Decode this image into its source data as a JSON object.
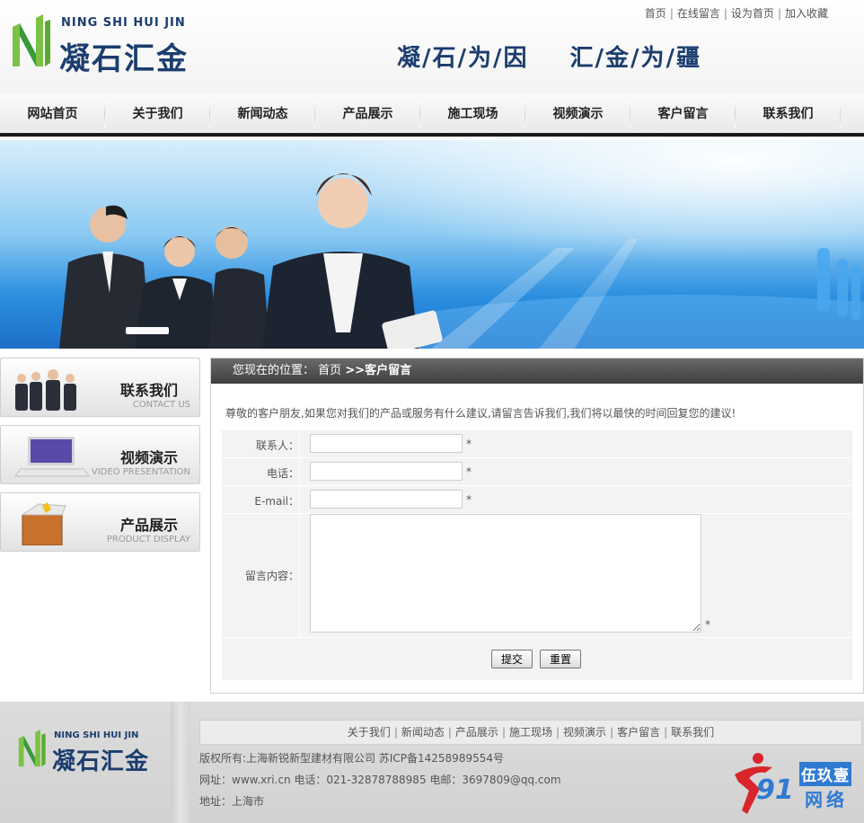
{
  "header": {
    "logo_en": "NING SHI HUI JIN",
    "logo_cn": "凝石汇金",
    "top_links": [
      "首页",
      "在线留言",
      "设为首页",
      "加入收藏"
    ],
    "slogan_left": "凝/石/为/因",
    "slogan_right": "汇/金/为/疆"
  },
  "nav": {
    "items": [
      "网站首页",
      "关于我们",
      "新闻动态",
      "产品展示",
      "施工现场",
      "视频演示",
      "客户留言",
      "联系我们"
    ]
  },
  "sidebar": {
    "items": [
      {
        "cn": "联系我们",
        "en": "CONTACT US"
      },
      {
        "cn": "视频演示",
        "en": "VIDEO PRESENTATION"
      },
      {
        "cn": "产品展示",
        "en": "PRODUCT DISPLAY"
      }
    ]
  },
  "content": {
    "crumb_prefix": "您现在的位置：",
    "crumb_home": "首页",
    "crumb_current": ">>客户留言",
    "intro": "尊敬的客户朋友,如果您对我们的产品或服务有什么建议,请留言告诉我们,我们将以最快的时间回复您的建议!",
    "form": {
      "contact_label": "联系人：",
      "phone_label": "电话：",
      "email_label": "E-mail：",
      "message_label": "留言内容：",
      "required_mark": "*",
      "contact_value": "",
      "phone_value": "",
      "email_value": "",
      "message_value": "",
      "submit_label": "提交",
      "reset_label": "重置"
    }
  },
  "footer": {
    "logo_en": "NING SHI HUI JIN",
    "logo_cn": "凝石汇金",
    "links": [
      "关于我们",
      "新闻动态",
      "产品展示",
      "施工现场",
      "视频演示",
      "客户留言",
      "联系我们"
    ],
    "copyright": "版权所有:上海新锐新型建材有限公司 苏ICP备14258989554号",
    "contact": "网址：www.xri.cn 电话：021-32878788985 电邮：3697809@qq.com",
    "address": "地址：上海市",
    "badge_num": "91",
    "badge_cn": "伍玖壹",
    "badge_net": "网络"
  },
  "colors": {
    "brand_navy": "#1b3d6e",
    "logo_green": "#7cc242",
    "nav_bottom_bar": "#1a1a1a",
    "crumb_bar": "#4a4a4a",
    "badge_blue": "#2f7bd2",
    "badge_red": "#d8262b"
  }
}
